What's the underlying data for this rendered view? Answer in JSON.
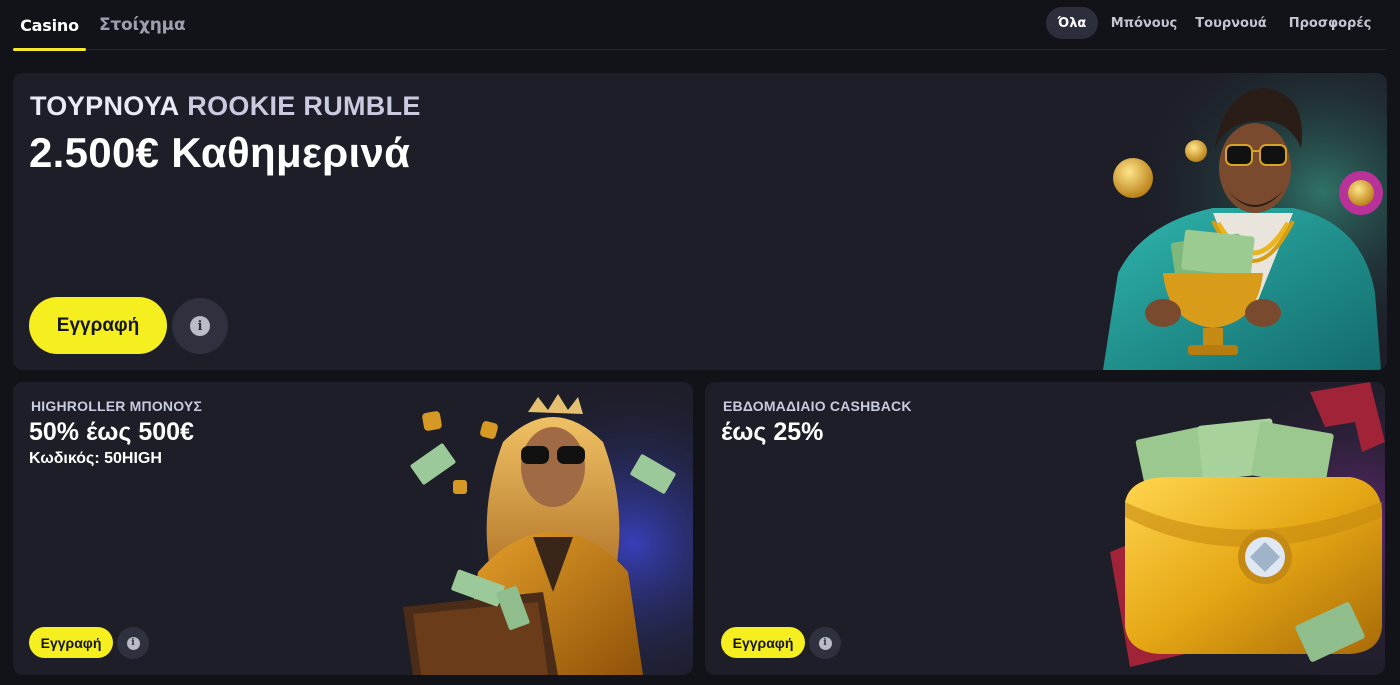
{
  "nav": {
    "tabs": [
      {
        "label": "Casino",
        "active": true
      },
      {
        "label": "Στοίχημα",
        "active": false
      }
    ],
    "filters": [
      {
        "label": "Όλα",
        "active": true
      },
      {
        "label": "Μπόνους",
        "active": false
      },
      {
        "label": "Τουρνουά",
        "active": false
      },
      {
        "label": "Προσφορές",
        "active": false
      }
    ]
  },
  "hero": {
    "title_part1": "ΤΟΥΡΝΟΥΑ",
    "title_part2": "ROOKIE RUMBLE",
    "subtitle": "2.500€ Καθημερινά",
    "cta_label": "Εγγραφή",
    "info_icon": "info-icon"
  },
  "promos": [
    {
      "label": "HIGHROLLER ΜΠΟΝΟΥΣ",
      "headline": "50% έως 500€",
      "code_label": "Κωδικός:",
      "code_value": "50HIGH",
      "cta_label": "Εγγραφή"
    },
    {
      "label": "ΕΒΔΟΜΑΔΙΑΙΟ CASHBACK",
      "headline": "έως 25%",
      "cta_label": "Εγγραφή"
    }
  ],
  "colors": {
    "accent": "#f5ef1f",
    "background": "#121318",
    "card": "#1d1e28"
  }
}
